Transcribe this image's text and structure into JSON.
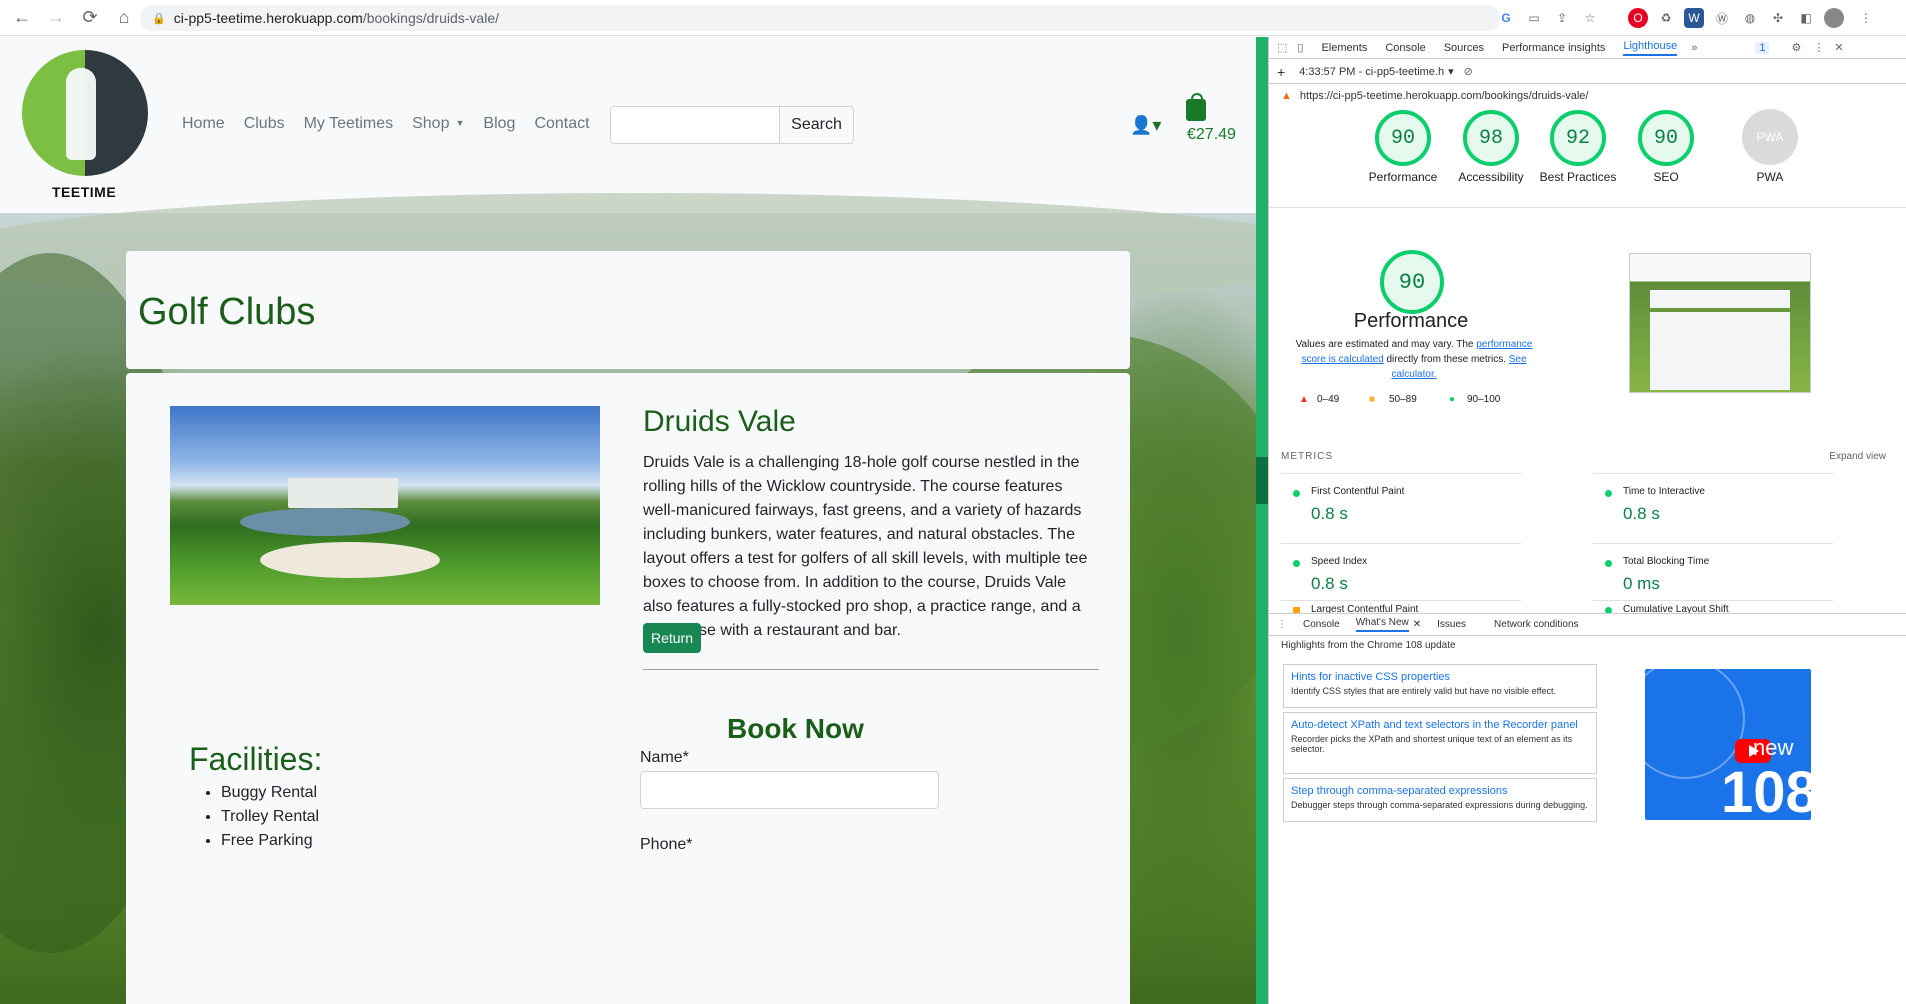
{
  "browser": {
    "url_host": "ci-pp5-teetime.herokuapp.com",
    "url_path": "/bookings/druids-vale/"
  },
  "site": {
    "logo_text": "TEETIME",
    "nav": [
      "Home",
      "Clubs",
      "My Teetimes",
      "Shop",
      "Blog",
      "Contact"
    ],
    "search_button": "Search",
    "cart_total": "€27.49"
  },
  "page": {
    "title": "Golf Clubs",
    "club_name": "Druids Vale",
    "club_description": "Druids Vale is a challenging 18-hole golf course nestled in the rolling hills of the Wicklow countryside. The course features well-manicured fairways, fast greens, and a variety of hazards including bunkers, water features, and natural obstacles. The layout offers a test for golfers of all skill levels, with multiple tee boxes to choose from. In addition to the course, Druids Vale also features a fully-stocked pro shop, a practice range, and a clubhouse with a restaurant and bar.",
    "return_button": "Return",
    "book_now": "Book Now",
    "facilities_title": "Facilities:",
    "facilities": [
      "Buggy Rental",
      "Trolley Rental",
      "Free Parking"
    ],
    "name_label": "Name*",
    "phone_label": "Phone*"
  },
  "devtools": {
    "tabs": [
      "Elements",
      "Console",
      "Sources",
      "Performance insights",
      "Lighthouse"
    ],
    "active_tab": "Lighthouse",
    "issues_badge": "1",
    "report_time": "4:33:57 PM - ci-pp5-teetime.h",
    "report_url": "https://ci-pp5-teetime.herokuapp.com/bookings/druids-vale/",
    "scores": [
      {
        "label": "Performance",
        "value": "90"
      },
      {
        "label": "Accessibility",
        "value": "98"
      },
      {
        "label": "Best Practices",
        "value": "92"
      },
      {
        "label": "SEO",
        "value": "90"
      }
    ],
    "pwa_label": "PWA",
    "pwa_badge": "PWA",
    "perf_score": "90",
    "perf_title": "Performance",
    "perf_note_1": "Values are estimated and may vary. The ",
    "perf_note_link": "performance score is calculated",
    "perf_note_2": " directly from these metrics. ",
    "perf_note_link2": "See calculator.",
    "legend": [
      "0–49",
      "50–89",
      "90–100"
    ],
    "metrics_title": "METRICS",
    "expand_view": "Expand view",
    "metrics": [
      {
        "name": "First Contentful Paint",
        "value": "0.8 s"
      },
      {
        "name": "Time to Interactive",
        "value": "0.8 s"
      },
      {
        "name": "Speed Index",
        "value": "0.8 s"
      },
      {
        "name": "Total Blocking Time",
        "value": "0 ms"
      },
      {
        "name": "Largest Contentful Paint",
        "value": ""
      },
      {
        "name": "Cumulative Layout Shift",
        "value": ""
      }
    ],
    "drawer_tabs": [
      "Console",
      "What's New",
      "Issues",
      "Network conditions"
    ],
    "highlights": "Highlights from the Chrome 108 update",
    "news": [
      {
        "title": "Hints for inactive CSS properties",
        "desc": "Identify CSS styles that are entirely valid but have no visible effect."
      },
      {
        "title": "Auto-detect XPath and text selectors in the Recorder panel",
        "desc": "Recorder picks the XPath and shortest unique text of an element as its selector."
      },
      {
        "title": "Step through comma-separated expressions",
        "desc": "Debugger steps through comma-separated expressions during debugging."
      }
    ],
    "banner_new": "new",
    "banner_num": "108"
  },
  "colors": {
    "brand_green": "#1a5e1a",
    "button_green": "#198754",
    "lighthouse_pass": "#0cce6b"
  }
}
